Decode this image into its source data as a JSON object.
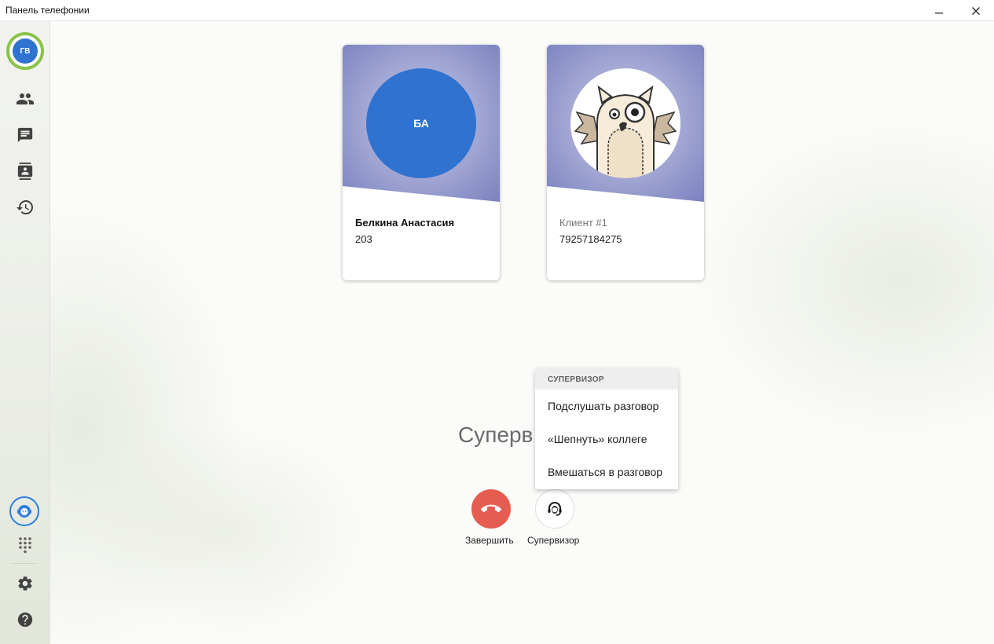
{
  "window": {
    "title": "Панель телефонии"
  },
  "user": {
    "initials": "ГВ"
  },
  "participants": [
    {
      "initials": "БА",
      "name": "Белкина Анастасия",
      "number": "203"
    },
    {
      "initials": "",
      "name": "Клиент #1",
      "number": "79257184275"
    }
  ],
  "main": {
    "title": "Суперв"
  },
  "supervisor_menu": {
    "header": "СУПЕРВИЗОР",
    "items": [
      {
        "label": "Подслушать разговор"
      },
      {
        "label": "«Шепнуть» коллеге"
      },
      {
        "label": "Вмешаться в разговор"
      }
    ]
  },
  "actions": {
    "hangup_label": "Завершить",
    "supervisor_label": "Супервизор"
  },
  "colors": {
    "accent_blue": "#2f72cf",
    "status_green": "#8bc34a",
    "hangup_red": "#e65c50",
    "card_purple": "#7b81bf"
  },
  "icons": {
    "sidebar": [
      "contacts-icon",
      "chat-icon",
      "address-book-icon",
      "history-icon",
      "supervisor-icon",
      "dialpad-icon",
      "settings-icon",
      "help-icon"
    ],
    "window": [
      "minimize-icon",
      "close-icon"
    ]
  }
}
